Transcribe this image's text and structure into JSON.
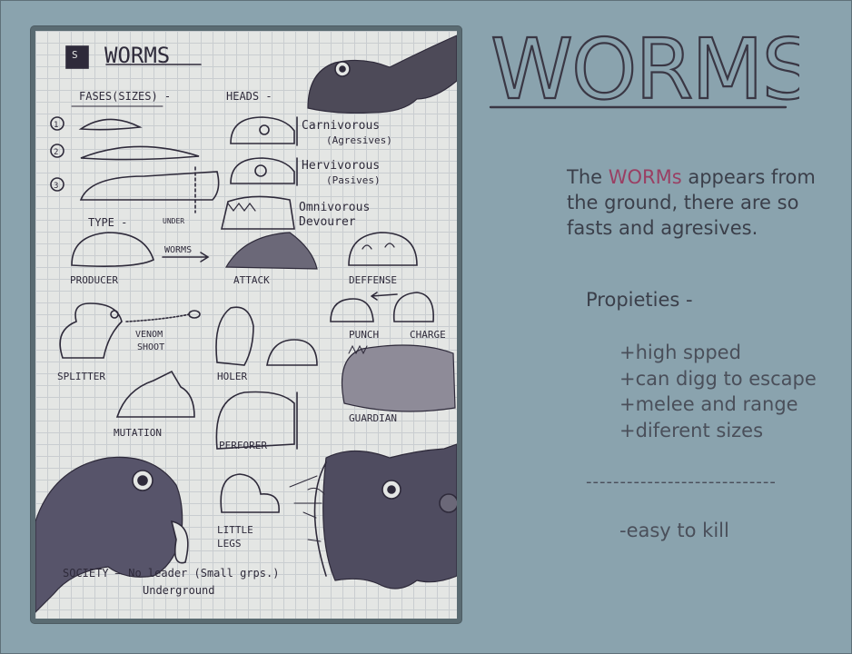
{
  "title": "WORMS",
  "description": {
    "prefix": "The ",
    "highlight": "WORMs",
    "suffix": " appears from the ground, there are so fasts and agresives."
  },
  "properties": {
    "heading": "Propieties -",
    "items": [
      "+high spped",
      "+can digg to escape",
      "+melee and range",
      "+diferent sizes"
    ],
    "divider": "----------------------------",
    "cons": [
      "-easy to kill"
    ]
  },
  "sketch": {
    "header_badge": "S",
    "title": "WORMS",
    "fases_label": "FASES(SIZES) -",
    "heads_label": "HEADS -",
    "sizes": [
      "1",
      "2",
      "3"
    ],
    "heads": [
      {
        "name": "Carnivorous",
        "sub": "(Agresives)"
      },
      {
        "name": "Hervivorous",
        "sub": "(Pasives)"
      },
      {
        "name": "Omnivorous",
        "sub": "Devourer"
      }
    ],
    "type_label": "TYPE -",
    "under_label": "UNDER",
    "worms_arrow": "WORMS",
    "types": [
      "PRODUCER",
      "ATTACK",
      "DEFFENSE"
    ],
    "punch": "PUNCH",
    "charge": "CHARGE",
    "venom": "VENOM",
    "shoot": "SHOOT",
    "variants": [
      "SPLITTER",
      "HOLER",
      "GUARDIAN",
      "MUTATION",
      "PERFORER"
    ],
    "little": "LITTLE",
    "legs": "LEGS",
    "society": "SOCIETY — No leader (Small grps.)",
    "underground": "Underground"
  },
  "colors": {
    "background": "#8aa3ae",
    "text": "#3b3f4a",
    "highlight": "#9a3f63",
    "ink": "#2e2a3a"
  }
}
